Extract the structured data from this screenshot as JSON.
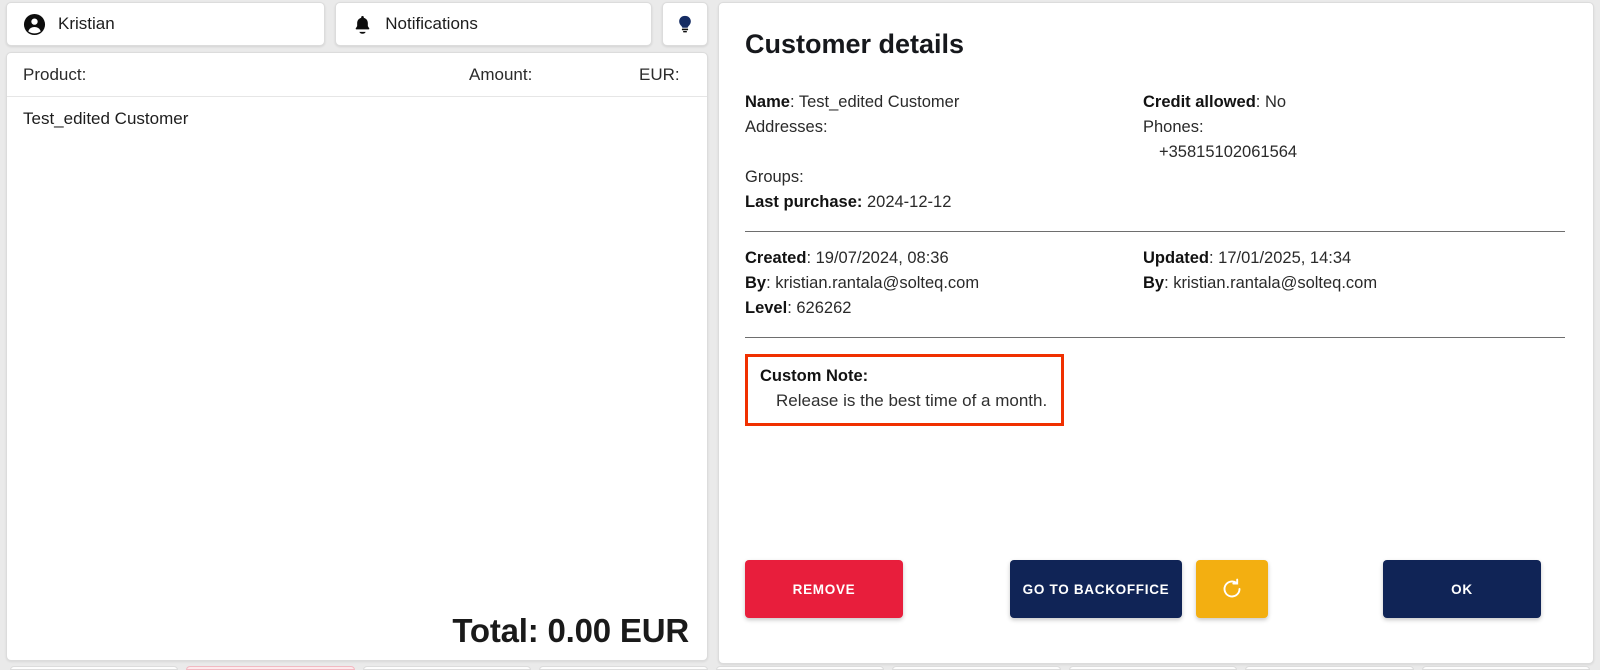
{
  "topbar": {
    "user_label": "Kristian",
    "user_icon": "account-circle-icon",
    "notifications_label": "Notifications",
    "notifications_icon": "bell-icon",
    "hint_icon": "lightbulb-icon"
  },
  "cart": {
    "columns": {
      "product": "Product:",
      "amount": "Amount:",
      "eur": "EUR:"
    },
    "rows": [
      {
        "product": "Test_edited Customer",
        "amount": "",
        "eur": ""
      }
    ],
    "total": "Total: 0.00 EUR"
  },
  "details": {
    "title": "Customer details",
    "left": {
      "name_label": "Name",
      "name_value": "Test_edited Customer",
      "addresses_label": "Addresses:",
      "groups_label": "Groups:",
      "last_purchase_label": "Last purchase:",
      "last_purchase_value": "2024-12-12"
    },
    "right": {
      "credit_allowed_label": "Credit allowed",
      "credit_allowed_value": "No",
      "phones_label": "Phones:",
      "phone_number": "+35815102061564"
    },
    "audit": {
      "created_label": "Created",
      "created_value": "19/07/2024, 08:36",
      "created_by_label": "By",
      "created_by_value": "kristian.rantala@solteq.com",
      "level_label": "Level",
      "level_value": "626262",
      "updated_label": "Updated",
      "updated_value": "17/01/2025, 14:34",
      "updated_by_label": "By",
      "updated_by_value": "kristian.rantala@solteq.com"
    },
    "custom_note": {
      "label": "Custom Note:",
      "value": "Release is the best time of a month.",
      "highlight_color": "#f03000"
    },
    "buttons": {
      "remove": "REMOVE",
      "backoffice": "GO TO BACKOFFICE",
      "refresh_icon": "refresh-icon",
      "ok": "OK"
    }
  },
  "colors": {
    "danger": "#e81e3c",
    "navy": "#102456",
    "amber": "#f3af11",
    "highlight": "#f03000",
    "panel_bg": "#ffffff",
    "app_bg": "#eaeaea"
  }
}
